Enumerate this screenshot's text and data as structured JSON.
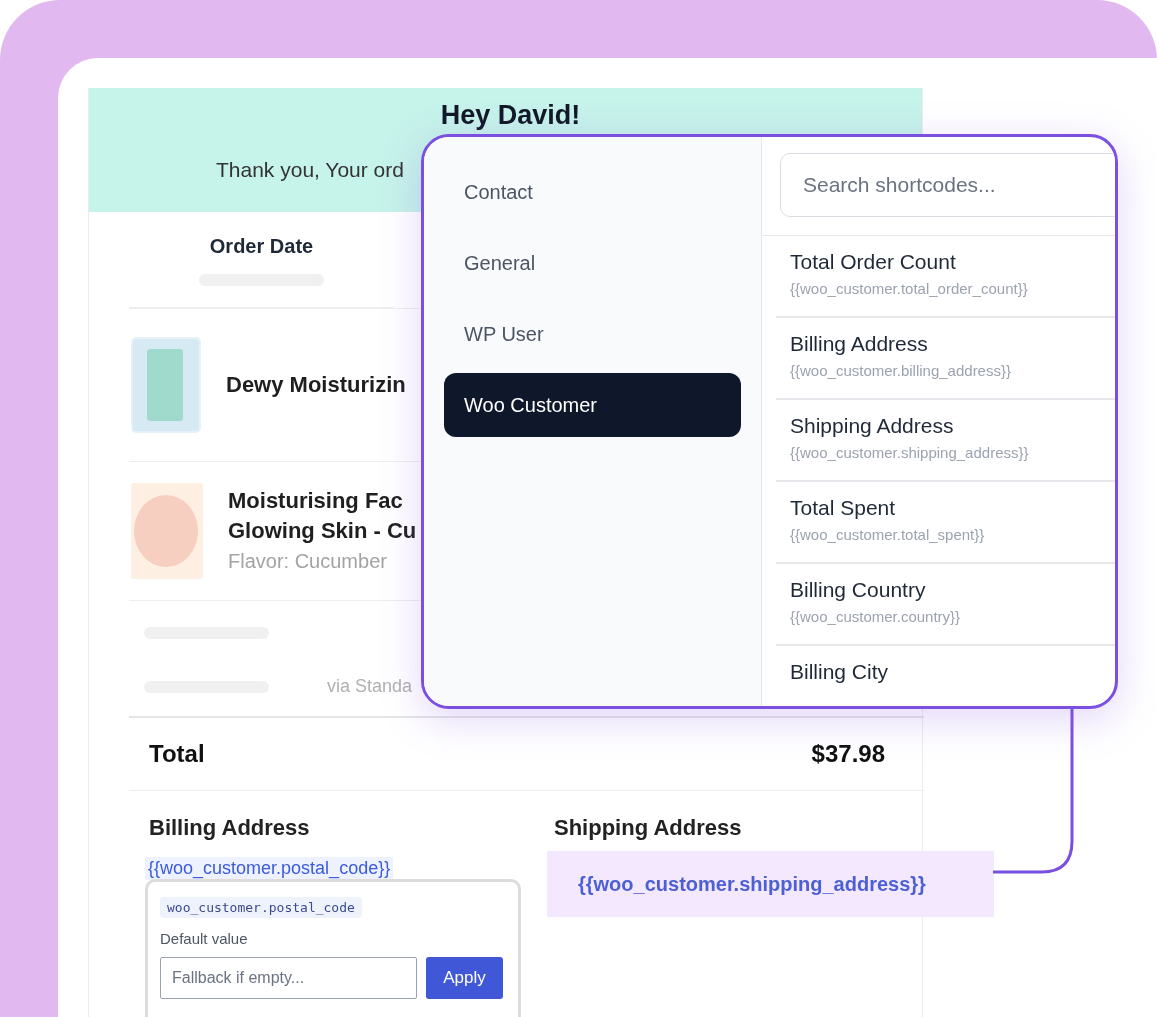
{
  "email": {
    "greeting": "Hey David!",
    "message": "Thank you, Your ord",
    "column": "Order Date",
    "items": [
      {
        "kind": "bottle",
        "title_lines": [
          "Dewy Moisturizin"
        ]
      },
      {
        "kind": "jar",
        "title_lines": [
          "Moisturising Fac",
          "Glowing Skin - Cu"
        ],
        "variant": "Flavor: Cucumber"
      }
    ],
    "payment_note": "via Standa",
    "total": {
      "label": "Total",
      "value": "$37.98"
    },
    "billing": {
      "title": "Billing Address",
      "shortcode": "{{woo_customer.postal_code}}"
    },
    "shipping": {
      "title": "Shipping Address",
      "shortcode": "{{woo_customer.shipping_address}}"
    }
  },
  "shortcode_popover": {
    "code": "woo_customer.postal_code",
    "label": "Default value",
    "placeholder": "Fallback if empty...",
    "button": "Apply"
  },
  "picker": {
    "categories": [
      {
        "label": "Contact",
        "selected": false
      },
      {
        "label": "General",
        "selected": false
      },
      {
        "label": "WP User",
        "selected": false
      },
      {
        "label": "Woo Customer",
        "selected": true
      }
    ],
    "search": {
      "placeholder": "Search shortcodes..."
    },
    "shortcodes": [
      {
        "title": "Total Order Count",
        "code": "{{woo_customer.total_order_count}}"
      },
      {
        "title": "Billing Address",
        "code": "{{woo_customer.billing_address}}"
      },
      {
        "title": "Shipping Address",
        "code": "{{woo_customer.shipping_address}}"
      },
      {
        "title": "Total Spent",
        "code": "{{woo_customer.total_spent}}"
      },
      {
        "title": "Billing Country",
        "code": "{{woo_customer.country}}"
      },
      {
        "title": "Billing City"
      }
    ]
  }
}
